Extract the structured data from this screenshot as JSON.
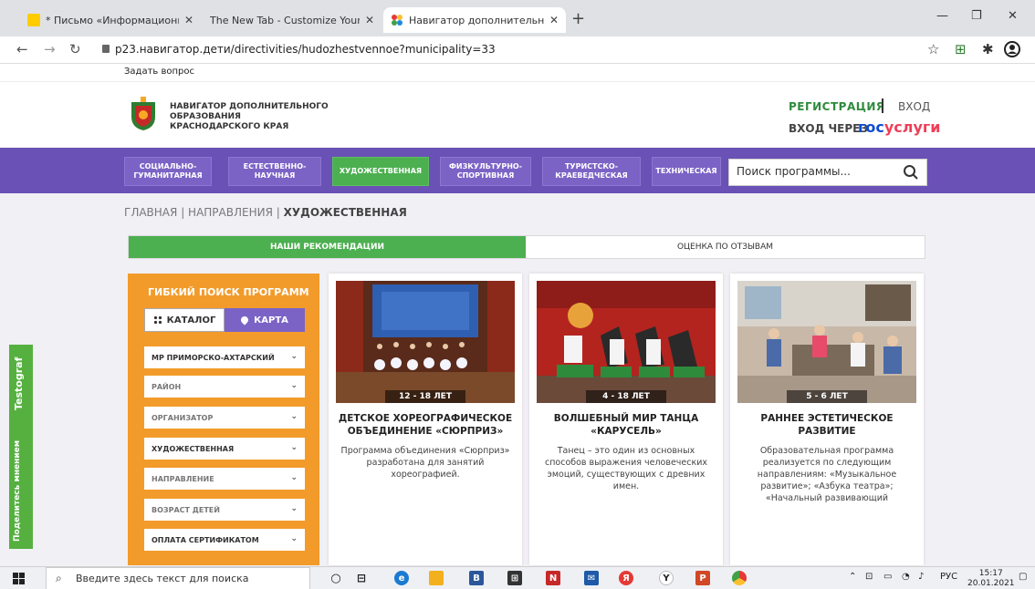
{
  "browser": {
    "tabs": [
      {
        "title": "* Письмо «Информационное со"
      },
      {
        "title": "The New Tab - Customize Your Start P"
      },
      {
        "title": "Навигатор дополнительного об"
      }
    ],
    "url": "p23.навигатор.дети/directivities/hudozhestvennoe?municipality=33"
  },
  "topbar": {
    "ask": "Задать вопрос"
  },
  "header": {
    "site_name": "НАВИГАТОР ДОПОЛНИТЕЛЬНОГО ОБРАЗОВАНИЯ КРАСНОДАРСКОГО КРАЯ",
    "register": "РЕГИСТРАЦИЯ",
    "login": "ВХОД",
    "gosuslugi_label": "ВХОД ЧЕРЕЗ",
    "gosuslugi_brand_1": "гос",
    "gosuslugi_brand_2": "услуги"
  },
  "categories": [
    {
      "label": "СОЦИАЛЬНО-ГУМАНИТАРНАЯ"
    },
    {
      "label": "ЕСТЕСТВЕННО-НАУЧНАЯ"
    },
    {
      "label": "ХУДОЖЕСТВЕННАЯ"
    },
    {
      "label": "ФИЗКУЛЬТУРНО-СПОРТИВНАЯ"
    },
    {
      "label": "ТУРИСТСКО-КРАЕВЕДЧЕСКАЯ"
    },
    {
      "label": "ТЕХНИЧЕСКАЯ"
    }
  ],
  "search": {
    "placeholder": "Поиск программы..."
  },
  "breadcrumb": {
    "home": "ГЛАВНАЯ",
    "section": "НАПРАВЛЕНИЯ",
    "current": "ХУДОЖЕСТВЕННАЯ"
  },
  "sort_tabs": {
    "recommend": "НАШИ РЕКОМЕНДАЦИИ",
    "reviews": "ОЦЕНКА ПО ОТЗЫВАМ"
  },
  "filter": {
    "title": "ГИБКИЙ ПОИСК ПРОГРАММ",
    "catalog": "КАТАЛОГ",
    "map": "КАРТА",
    "selects": [
      {
        "value": "МР ПРИМОРСКО-АХТАРСКИЙ"
      },
      {
        "value": "РАЙОН"
      },
      {
        "value": "ОРГАНИЗАТОР"
      },
      {
        "value": "ХУДОЖЕСТВЕННАЯ"
      },
      {
        "value": "НАПРАВЛЕНИЕ"
      },
      {
        "value": "ВОЗРАСТ ДЕТЕЙ"
      },
      {
        "value": "ОПЛАТА СЕРТИФИКАТОМ"
      }
    ]
  },
  "cards": [
    {
      "age": "12 - 18 ЛЕТ",
      "title": "ДЕТСКОЕ ХОРЕОГРАФИЧЕСКОЕ ОБЪЕДИНЕНИЕ «СЮРПРИЗ»",
      "desc": "Программа объединения «Сюрприз» разработана для занятий хореографией."
    },
    {
      "age": "4 - 18 ЛЕТ",
      "title": "ВОЛШЕБНЫЙ МИР ТАНЦА «КАРУСЕЛЬ»",
      "desc": "Танец – это один из основных способов выражения человеческих эмоций, существующих с древних имен."
    },
    {
      "age": "5 - 6 ЛЕТ",
      "title": "РАННЕЕ ЭСТЕТИЧЕСКОЕ РАЗВИТИЕ",
      "desc": "Образовательная программа реализуется по следующим направлениям: «Музыкальное развитие»; «Азбука театра»; «Начальный развивающий"
    }
  ],
  "feedback": {
    "label": "Поделитесь мнением",
    "brand": "Testograf"
  },
  "taskbar": {
    "search_placeholder": "Введите здесь текст для поиска",
    "lang": "РУС",
    "time": "15:17",
    "date": "20.01.2021"
  },
  "colors": {
    "purple": "#6a51b6",
    "green": "#4caf50",
    "orange": "#f29b2b",
    "reg_green": "#2e8b3c"
  }
}
